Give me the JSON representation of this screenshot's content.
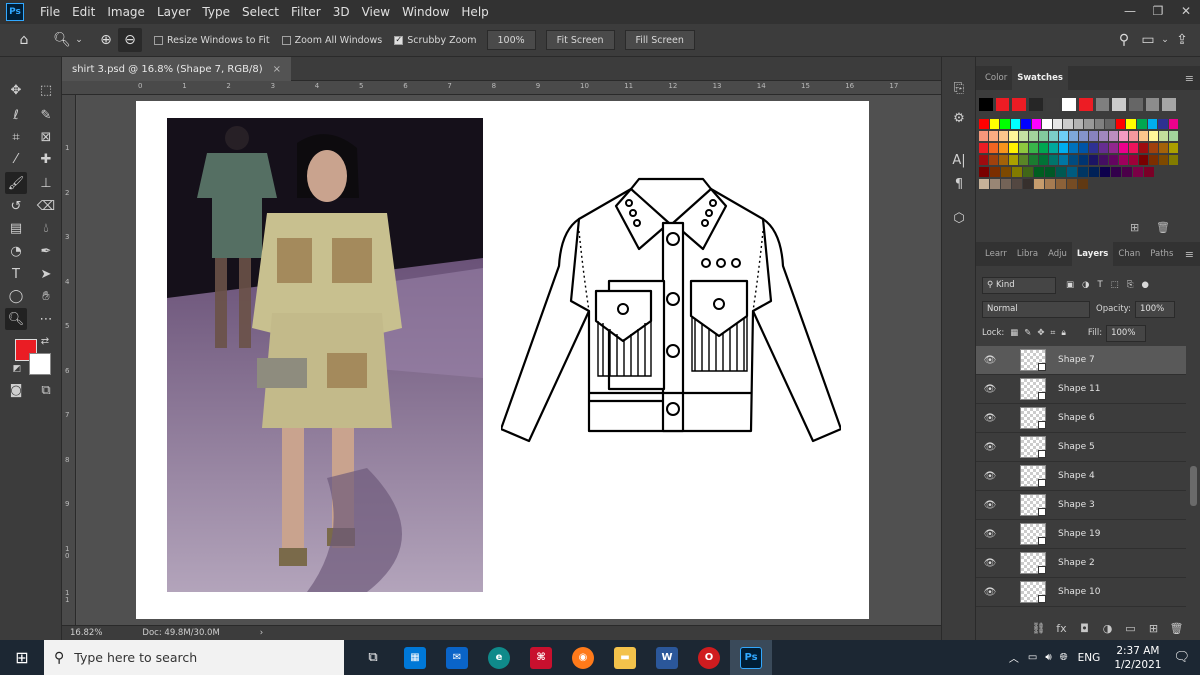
{
  "app": {
    "logo": "Ps"
  },
  "menu": [
    "File",
    "Edit",
    "Image",
    "Layer",
    "Type",
    "Select",
    "Filter",
    "3D",
    "View",
    "Window",
    "Help"
  ],
  "window_controls": {
    "minimize": "—",
    "restore": "❐",
    "close": "✕"
  },
  "options": {
    "resize_windows": "Resize Windows to Fit",
    "zoom_all": "Zoom All Windows",
    "scrubby_zoom": "Scrubby Zoom",
    "zoom_100": "100%",
    "fit_screen": "Fit Screen",
    "fill_screen": "Fill Screen"
  },
  "document": {
    "tab_title": "shirt 3.psd @ 16.8% (Shape 7, RGB/8)",
    "close": "×"
  },
  "ruler_top": [
    "0",
    "1",
    "2",
    "3",
    "4",
    "5",
    "6",
    "7",
    "8",
    "9",
    "10",
    "11",
    "12",
    "13",
    "14",
    "15",
    "16",
    "17"
  ],
  "ruler_left": [
    "1",
    "2",
    "3",
    "4",
    "5",
    "6",
    "7",
    "8",
    "9",
    "1 0",
    "1 1"
  ],
  "status": {
    "zoom": "16.82%",
    "doc": "Doc: 49.8M/30.0M",
    "arrow": "›"
  },
  "panels": {
    "top_tabs": [
      "Color",
      "Swatches"
    ],
    "top_active": "Swatches",
    "layer_tabs": [
      "Learr",
      "Libra",
      "Adju",
      "Layers",
      "Chan",
      "Paths"
    ],
    "layer_active": "Layers",
    "kind": "Kind",
    "blend_mode": "Normal",
    "opacity_label": "Opacity:",
    "opacity_value": "100%",
    "lock_label": "Lock:",
    "fill_label": "Fill:",
    "fill_value": "100%"
  },
  "swatch_colors": [
    [
      "#000000",
      "#ed1c24",
      "#ed1c24",
      "#262626",
      "#3d3d3d",
      "#ffffff",
      "#ed1c24",
      "#7f7f7f",
      "#cccccc",
      "#666666",
      "#8c8c8c",
      "#a6a6a6"
    ],
    [],
    [
      "#ff0000",
      "#ffff00",
      "#00ff00",
      "#00ffff",
      "#0000ff",
      "#ff00ff",
      "#ffffff",
      "#e6e6e6",
      "#cccccc",
      "#b3b3b3",
      "#999999",
      "#808080",
      "#666666",
      "#ff0000",
      "#ffff00",
      "#00a651",
      "#00aeef",
      "#2e3192",
      "#ec008c"
    ],
    [
      "#f7977a",
      "#fbad82",
      "#fdc68c",
      "#fff799",
      "#c5e3a3",
      "#a2d39c",
      "#82ca9d",
      "#7bcdc8",
      "#6ecff6",
      "#7ea7d8",
      "#8493ca",
      "#8882be",
      "#a187be",
      "#bc8dbf",
      "#f49ac2",
      "#f6989d",
      "#fdc68c",
      "#fff799",
      "#c4df9b",
      "#a3d39c"
    ],
    [
      "#ed1c24",
      "#f26522",
      "#f7941d",
      "#fff200",
      "#8dc73f",
      "#39b54a",
      "#00a651",
      "#00a99d",
      "#00aeef",
      "#0072bc",
      "#0054a6",
      "#2e3192",
      "#662d91",
      "#92278f",
      "#ec008c",
      "#ed145b",
      "#9e0b0f",
      "#a0410d",
      "#a36209",
      "#aba000"
    ],
    [
      "#9e0b0f",
      "#a0410d",
      "#a36209",
      "#aba000",
      "#598527",
      "#1a7b30",
      "#007236",
      "#00746b",
      "#0076a3",
      "#004b80",
      "#003471",
      "#1b1464",
      "#440e62",
      "#630460",
      "#9e005d",
      "#9e0039",
      "#790000",
      "#7b2e00",
      "#7d4900",
      "#827b00"
    ],
    [
      "#790000",
      "#7b2e00",
      "#7d4900",
      "#827b00",
      "#406618",
      "#005e20",
      "#005826",
      "#005952",
      "#005b7f",
      "#003663",
      "#002157",
      "#0d004c",
      "#32004b",
      "#4b0049",
      "#7b0046",
      "#7a0026"
    ],
    [
      "#c7b299",
      "#998675",
      "#736357",
      "#534741",
      "#37302d",
      "#c69c6d",
      "#a67c52",
      "#8c6239",
      "#754c24",
      "#603913"
    ]
  ],
  "layers": [
    "Shape 7",
    "Shape 11",
    "Shape 6",
    "Shape 5",
    "Shape 4",
    "Shape 3",
    "Shape 19",
    "Shape 2",
    "Shape 10"
  ],
  "selected_layer": "Shape 7",
  "taskbar": {
    "search_placeholder": "Type here to search",
    "lang": "ENG",
    "time": "2:37 AM",
    "date": "1/2/2021",
    "apps": [
      "W",
      "Ps"
    ]
  }
}
